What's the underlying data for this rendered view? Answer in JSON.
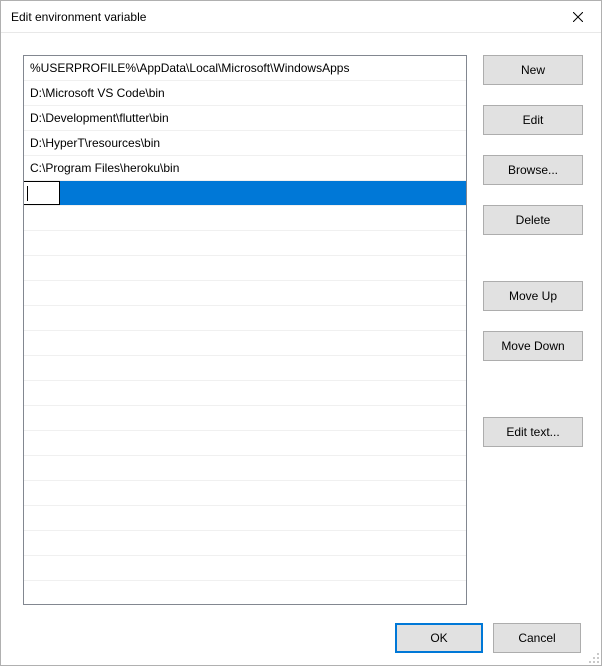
{
  "window": {
    "title": "Edit environment variable"
  },
  "list": {
    "items": [
      "%USERPROFILE%\\AppData\\Local\\Microsoft\\WindowsApps",
      "D:\\Microsoft VS Code\\bin",
      "D:\\Development\\flutter\\bin",
      "D:\\HyperT\\resources\\bin",
      "C:\\Program Files\\heroku\\bin"
    ],
    "editing_index": 5,
    "editing_value": ""
  },
  "buttons": {
    "new": "New",
    "edit": "Edit",
    "browse": "Browse...",
    "delete": "Delete",
    "move_up": "Move Up",
    "move_down": "Move Down",
    "edit_text": "Edit text...",
    "ok": "OK",
    "cancel": "Cancel"
  }
}
